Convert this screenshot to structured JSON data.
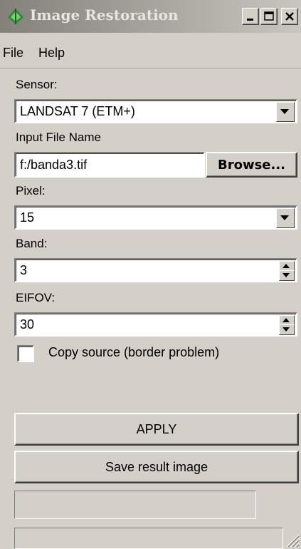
{
  "window": {
    "title": "Image Restoration",
    "icon": "app-leaf-icon",
    "controls": [
      "minimize-icon",
      "maximize-icon",
      "close-icon"
    ]
  },
  "menu": {
    "file": "File",
    "help": "Help"
  },
  "sensor": {
    "label": "Sensor:",
    "value": "LANDSAT 7 (ETM+)"
  },
  "input_file": {
    "label": "Input File Name",
    "value": "f:/banda3.tif",
    "browse_label": "Browse..."
  },
  "pixel": {
    "label": "Pixel:",
    "value": "15"
  },
  "band": {
    "label": "Band:",
    "value": "3"
  },
  "eifov": {
    "label": "EIFOV:",
    "value": "30"
  },
  "copy_source": {
    "label": "Copy source (border problem)",
    "checked": false
  },
  "buttons": {
    "apply": "APPLY",
    "save": "Save result image"
  },
  "colors": {
    "face": "#d4d0c8",
    "title_gradient_start": "#84807a",
    "title_gradient_end": "#c9c6c0"
  }
}
